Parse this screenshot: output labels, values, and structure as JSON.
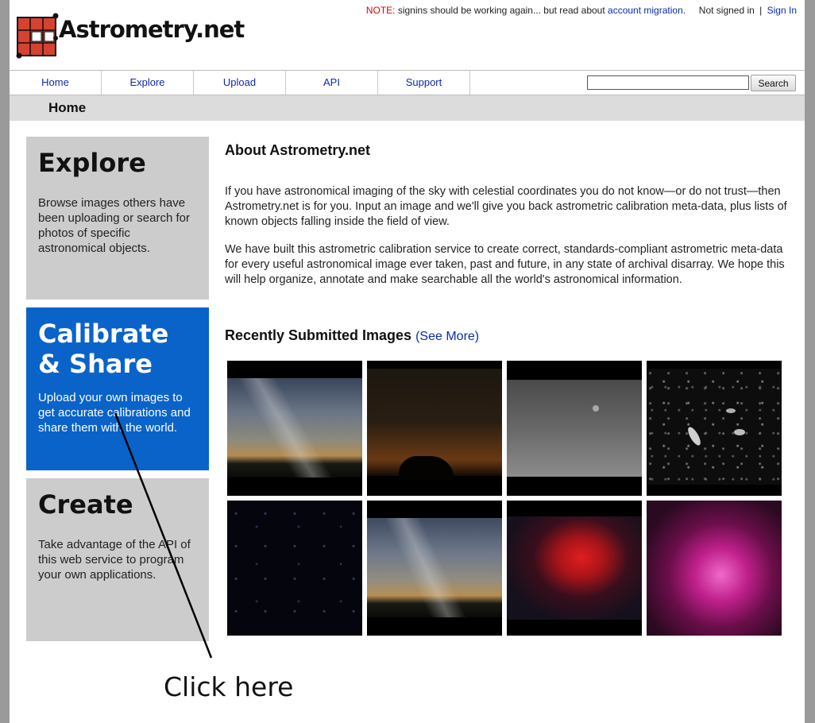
{
  "site": {
    "logo_text": "Astrometry.net"
  },
  "topbar": {
    "note_label": "NOTE:",
    "note_text": "signins should be working again... but read about",
    "note_link": "account migration",
    "note_end": ".",
    "status": "Not signed in",
    "separator": "|",
    "signin": "Sign In"
  },
  "nav": {
    "items": [
      {
        "label": "Home"
      },
      {
        "label": "Explore"
      },
      {
        "label": "Upload"
      },
      {
        "label": "API"
      },
      {
        "label": "Support"
      }
    ],
    "search_value": "",
    "search_button": "Search"
  },
  "page_title": "Home",
  "panels": {
    "explore": {
      "title": "Explore",
      "text": "Browse images others have been uploading or search for photos of specific astronomical objects."
    },
    "calibrate": {
      "title": "Calibrate & Share",
      "text": "Upload your own images to get accurate calibrations and share them with the world."
    },
    "create": {
      "title": "Create",
      "text": "Take advantage of the API of this web service to program your own applications."
    }
  },
  "about": {
    "heading": "About Astrometry.net",
    "p1": "If you have astronomical imaging of the sky with celestial coordinates you do not know—or do not trust—then Astrometry.net is for you. Input an image and we'll give you back astrometric calibration meta-data, plus lists of known objects falling inside the field of view.",
    "p2": "We have built this astrometric calibration service to create correct, standards-compliant astrometric meta-data for every useful astronomical image ever taken, past and future, in any state of archival disarray. We hope this will help organize, annotate and make searchable all the world's astronomical information."
  },
  "recent": {
    "heading": "Recently Submitted Images",
    "see_more": "(See More)"
  },
  "annotation": {
    "text": "Click here"
  },
  "colors": {
    "link": "#0b2cad",
    "active_panel": "#0a63c9",
    "panel": "#cccccc",
    "note": "#e00000"
  }
}
